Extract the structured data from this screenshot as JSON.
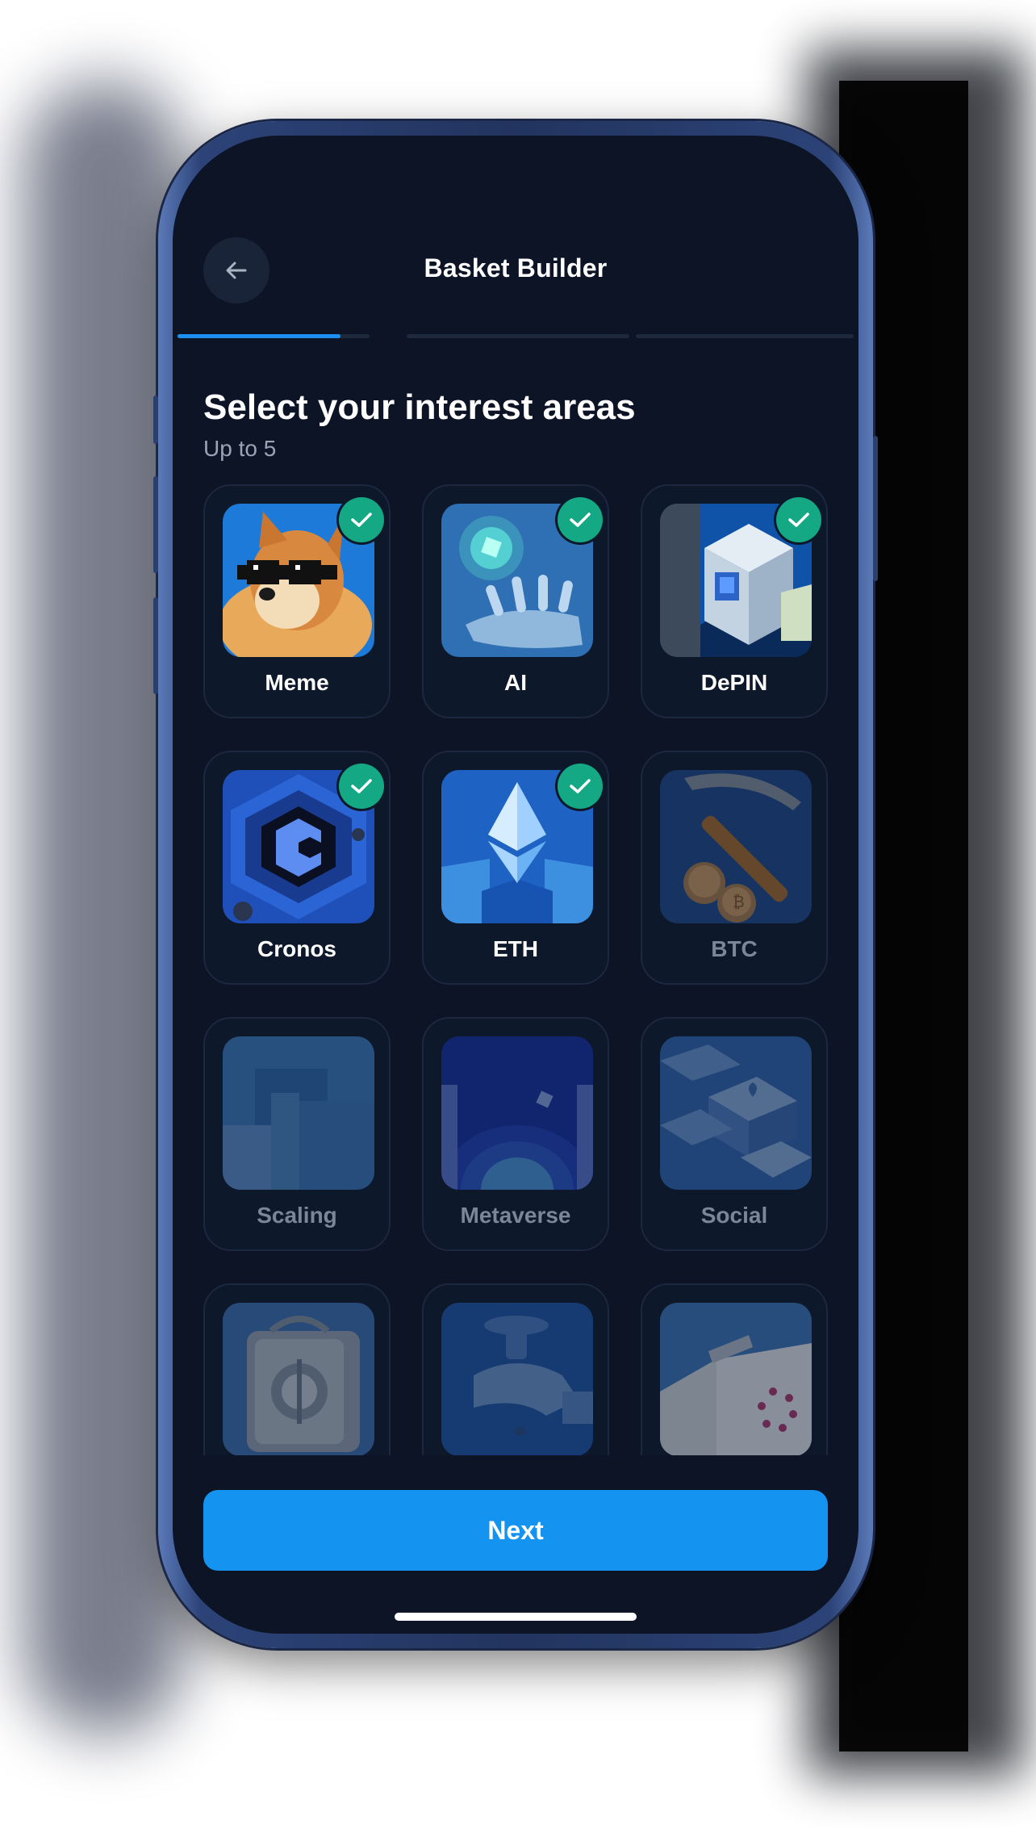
{
  "header": {
    "title": "Basket Builder",
    "back_icon": "arrow-left-icon",
    "progress": {
      "steps": 3,
      "current": 1,
      "current_fraction": 0.85
    }
  },
  "main": {
    "heading": "Select your interest areas",
    "subheading": "Up to 5",
    "categories": [
      {
        "label": "Meme",
        "selected": true,
        "image": "doge-meme-image"
      },
      {
        "label": "AI",
        "selected": true,
        "image": "robot-hand-image"
      },
      {
        "label": "DePIN",
        "selected": true,
        "image": "isometric-computer-image"
      },
      {
        "label": "Cronos",
        "selected": true,
        "image": "cronos-logo-image"
      },
      {
        "label": "ETH",
        "selected": true,
        "image": "ethereum-crystal-image"
      },
      {
        "label": "BTC",
        "selected": false,
        "image": "bitcoin-pickaxe-image"
      },
      {
        "label": "Scaling",
        "selected": false,
        "image": "blocks-image"
      },
      {
        "label": "Metaverse",
        "selected": false,
        "image": "portal-tunnel-image"
      },
      {
        "label": "Social",
        "selected": false,
        "image": "reaction-keys-image"
      },
      {
        "label": "",
        "selected": false,
        "image": "vault-safe-image"
      },
      {
        "label": "",
        "selected": false,
        "image": "faucet-image"
      },
      {
        "label": "",
        "selected": false,
        "image": "polkadot-folder-image"
      }
    ]
  },
  "footer": {
    "next_label": "Next"
  },
  "colors": {
    "background": "#0c1426",
    "card": "#0e182b",
    "accent": "#1593f0",
    "check": "#14a884",
    "progress_active": "#1d8ff0"
  }
}
